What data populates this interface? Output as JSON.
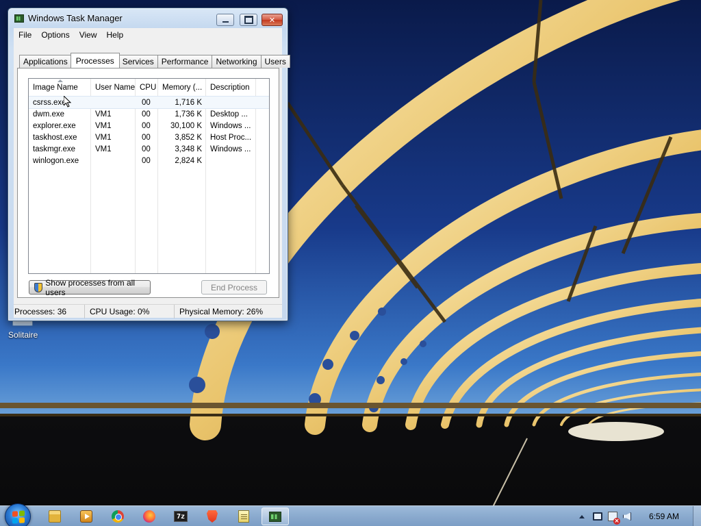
{
  "desktop": {
    "icons": [
      {
        "label": "Solitaire"
      }
    ]
  },
  "task_manager": {
    "title": "Windows Task Manager",
    "menu": [
      "File",
      "Options",
      "View",
      "Help"
    ],
    "tabs": [
      "Applications",
      "Processes",
      "Services",
      "Performance",
      "Networking",
      "Users"
    ],
    "active_tab": "Processes",
    "columns": [
      "Image Name",
      "User Name",
      "CPU",
      "Memory (...",
      "Description"
    ],
    "sorted_column": "Image Name",
    "processes": [
      {
        "image_name": "csrss.exe",
        "user_name": "",
        "cpu": "00",
        "memory": "1,716 K",
        "description": ""
      },
      {
        "image_name": "dwm.exe",
        "user_name": "VM1",
        "cpu": "00",
        "memory": "1,736 K",
        "description": "Desktop ..."
      },
      {
        "image_name": "explorer.exe",
        "user_name": "VM1",
        "cpu": "00",
        "memory": "30,100 K",
        "description": "Windows ..."
      },
      {
        "image_name": "taskhost.exe",
        "user_name": "VM1",
        "cpu": "00",
        "memory": "3,852 K",
        "description": "Host Proc..."
      },
      {
        "image_name": "taskmgr.exe",
        "user_name": "VM1",
        "cpu": "00",
        "memory": "3,348 K",
        "description": "Windows ..."
      },
      {
        "image_name": "winlogon.exe",
        "user_name": "",
        "cpu": "00",
        "memory": "2,824 K",
        "description": ""
      }
    ],
    "selected_row": "csrss.exe",
    "show_all_button": "Show processes from all users",
    "end_process_button": "End Process",
    "status": {
      "processes": "Processes: 36",
      "cpu_usage": "CPU Usage: 0%",
      "physical_memory": "Physical Memory: 26%"
    }
  },
  "taskbar": {
    "pinned": [
      "folder-icon",
      "media-player-icon",
      "chrome-icon",
      "firefox-icon",
      "7zip-icon",
      "brave-icon",
      "notepad-icon",
      "task-manager-icon"
    ],
    "sevenzip_glyph": "7z",
    "active_item": "task-manager-icon",
    "clock": "6:59 AM"
  },
  "colors": {
    "accent": "#3c5a7c",
    "selection": "#f3f8fd",
    "close_button": "#c3381f"
  }
}
